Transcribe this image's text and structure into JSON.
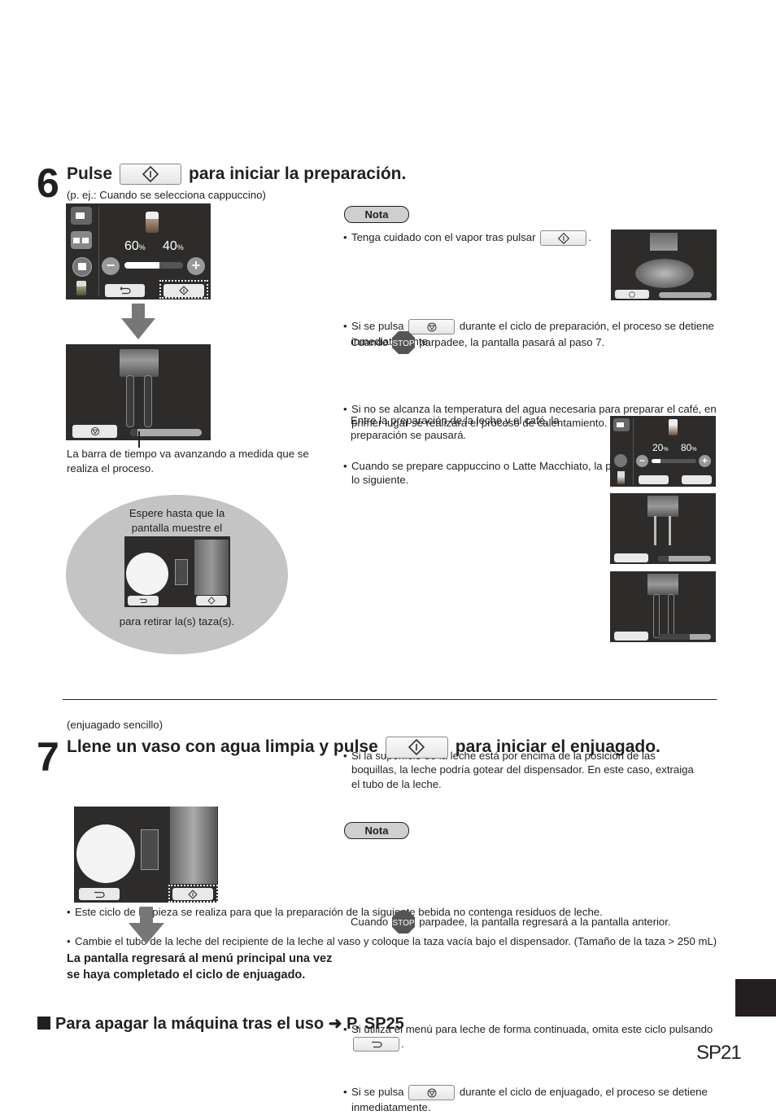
{
  "step6": {
    "number": "6",
    "title_before": "Pulse",
    "title_after": "para iniciar la preparación.",
    "example": "(p. ej.: Cuando se selecciona cappuccino)",
    "screen1": {
      "milk_percent": "60",
      "coffee_percent": "40",
      "percent_sign": "%",
      "milk_ratio": 0.6
    },
    "screen2": {
      "progress": 0.1
    },
    "progress_caption": "La barra de tiempo va avanzando a medida que se realiza el proceso.",
    "bubble": {
      "line1": "Espere hasta que la",
      "line2": "pantalla muestre el",
      "line3": "para retirar la(s) taza(s)."
    },
    "nota_label": "Nota",
    "notes": {
      "n1": "Tenga cuidado con el vapor tras pulsar",
      "n1_end": ".",
      "n2_a": "Si se pulsa",
      "n2_b": "durante el ciclo de preparación, el proceso se detiene inmediatamente.",
      "n2_c1": "Cuando",
      "n2_c2": "parpadee, la pantalla pasará al paso 7.",
      "n3": "Si no se alcanza la temperatura del agua necesaria para preparar el café, en primer lugar se realizará el proceso de calentamiento.",
      "n4": "Cuando se prepare cappuccino o Latte Macchiato, la pantalla mostrará lo siguiente.",
      "n4_sub": "Entre la preparación de la leche y el café, la preparación se pausará.",
      "n5": "Si la superficie de la leche está por encima de la posición de las boquillas, la leche podría gotear del dispensador. En este caso, extraiga el tubo de la leche."
    },
    "mini_screen": {
      "milk_percent": "20",
      "coffee_percent": "80",
      "percent_sign": "%",
      "milk_ratio": 0.2
    },
    "mini_progress_1": 0.2,
    "mini_progress_2": 0.6,
    "stop_label": "STOP"
  },
  "step7": {
    "number": "7",
    "subtitle": "(enjuagado sencillo)",
    "title_before": "Llene un vaso con agua limpia y pulse",
    "title_after": "para iniciar el enjuagado.",
    "bullet1": "Este ciclo de limpieza se realiza para que la preparación de la siguiente bebida no contenga residuos de leche.",
    "bullet2": "Cambie el tubo de la leche del recipiente de la leche al vaso y coloque la taza vacía bajo el dispensador. (Tamaño de la taza > 250 mL)",
    "result_text": "La pantalla regresará al menú principal una vez se haya completado el ciclo de enjuagado.",
    "nota_label": "Nota",
    "note1_a": "Si utiliza el menú para leche de forma continuada, omita este ciclo pulsando",
    "note1_end": ".",
    "note2_a": "Si se pulsa",
    "note2_b": "durante el ciclo de enjuagado, el proceso se detiene inmediatamente.",
    "note2_c1": "Cuando",
    "note2_c2": "parpadee, la pantalla regresará a la pantalla anterior.",
    "stop_label": "STOP"
  },
  "footer": {
    "power_off": "Para apagar la máquina tras el uso ➜ P. SP25",
    "page_number": "SP21"
  }
}
